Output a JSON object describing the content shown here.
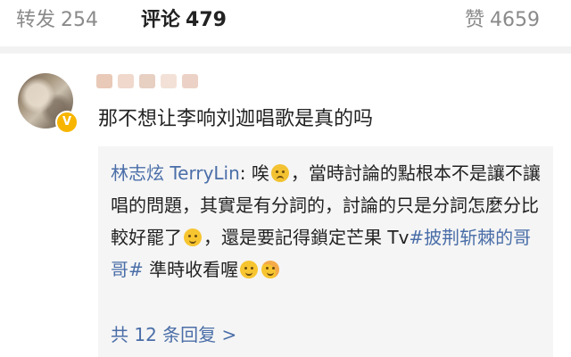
{
  "tabs": {
    "repost": {
      "label": "转发",
      "count": "254"
    },
    "comments": {
      "label": "评论",
      "count": "479"
    },
    "likes": {
      "label": "赞",
      "count": "4659"
    }
  },
  "comment": {
    "text": "那不想让李响刘迦唱歌是真的吗",
    "verified_icon": "v-badge-icon"
  },
  "reply": {
    "author": "林志炫 TerryLin",
    "segments": [
      "唉",
      "，當時討論的點根本不是讓不讓唱的問題，其實是有分詞的，討論的只是分詞怎麼分比較好罷了",
      "，還是要記得鎖定芒果 Tv",
      "#披荆斩棘的哥哥#",
      " 準時收看喔"
    ],
    "more_link": "共 12 条回复 >"
  },
  "colors": {
    "link": "#4a6ea8",
    "badge": "#f7b500",
    "reply_bg": "#f5f5f5"
  }
}
